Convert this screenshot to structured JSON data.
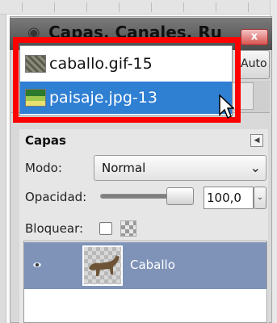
{
  "window": {
    "title": "Capas, Canales, Ru",
    "close_label": "x",
    "auto_label": "Auto"
  },
  "image_menu": {
    "items": [
      {
        "label": "caballo.gif-15",
        "selected": false
      },
      {
        "label": "paisaje.jpg-13",
        "selected": true
      }
    ],
    "highlight_color": "#2f7fd3",
    "annotation_color": "#ff0000"
  },
  "layers_panel": {
    "title": "Capas",
    "mode": {
      "label": "Modo:",
      "value": "Normal"
    },
    "opacity": {
      "label": "Opacidad:",
      "value": "100,0",
      "fraction": 1.0
    },
    "lock": {
      "label": "Bloquear:",
      "checked": false
    },
    "layers": [
      {
        "name": "Caballo",
        "visible": true,
        "selected": true
      }
    ],
    "selection_color": "#7f93b8"
  },
  "icons": [
    "gimp-dock-icon",
    "close-icon",
    "menu-icon",
    "chevron-down-icon",
    "spin-icon",
    "checkerboard-icon",
    "eye-icon",
    "mouse-pointer-icon"
  ]
}
